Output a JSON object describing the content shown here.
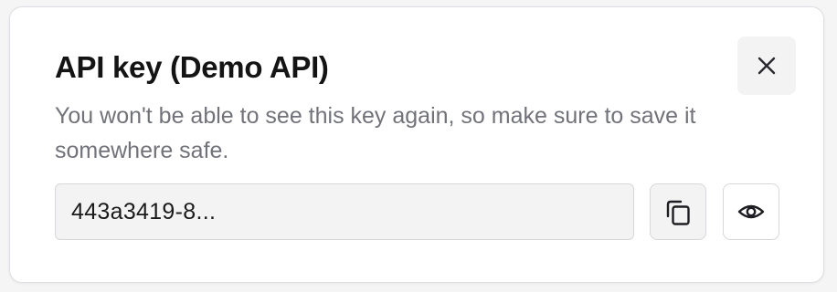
{
  "dialog": {
    "title": "API key (Demo API)",
    "description": "You won't be able to see this key again, so make sure to save it somewhere safe.",
    "close_icon": "close-icon",
    "key_value": "443a3419-8...",
    "copy_icon": "copy-icon",
    "reveal_icon": "eye-icon"
  },
  "colors": {
    "title": "#141414",
    "description": "#72727a",
    "field_background": "#f3f3f4",
    "border": "#d8d8dc"
  }
}
